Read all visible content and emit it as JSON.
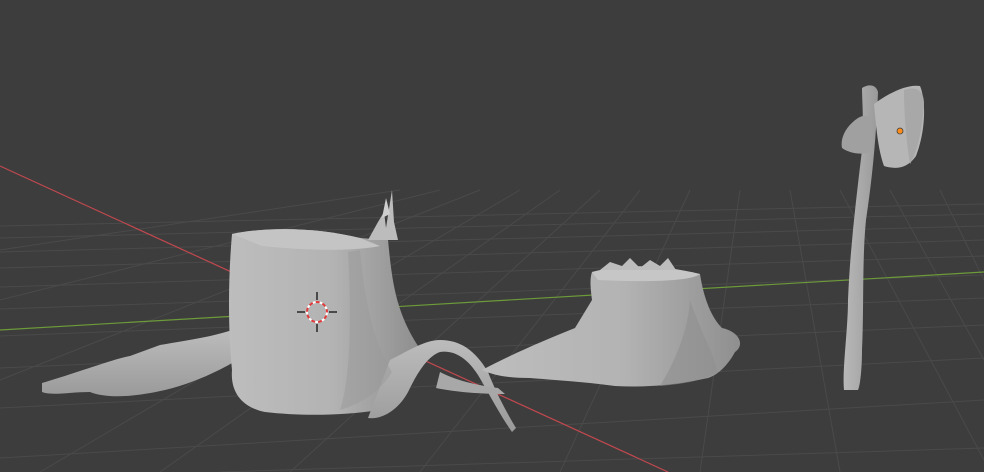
{
  "viewport": {
    "colors": {
      "background": "#3d3d3d",
      "grid_line": "#4a4a4a",
      "x_axis": "#c0484f",
      "y_axis": "#6d9a3a",
      "mesh_light": "#b9b9b9",
      "mesh_mid": "#a2a2a2",
      "mesh_dark": "#8a8a8a",
      "origin_dot": "#ff8c1a",
      "cursor_red": "#e03a3a",
      "cursor_white": "#ffffff"
    },
    "objects": [
      {
        "id": "tree-stump-large",
        "icon": "mesh-object"
      },
      {
        "id": "tree-stump-small",
        "icon": "mesh-object"
      },
      {
        "id": "axe",
        "icon": "mesh-object"
      }
    ],
    "cursor_icon": "3d-cursor-icon"
  }
}
